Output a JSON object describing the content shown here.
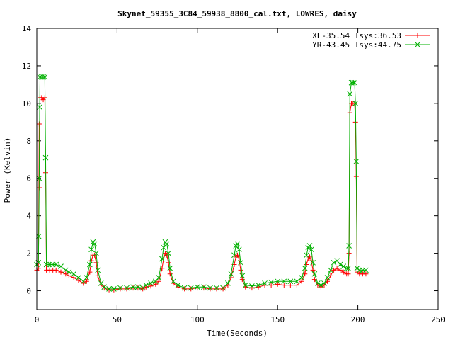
{
  "chart_data": {
    "type": "line",
    "title": "Skynet_59355_3C84_59938_8800_cal.txt, LOWRES, daisy",
    "xlabel": "Time(Seconds)",
    "ylabel": "Power (Kelvin)",
    "xlim": [
      0,
      250
    ],
    "ylim": [
      -1,
      14
    ],
    "xticks": [
      0,
      50,
      100,
      150,
      200,
      250
    ],
    "yticks": [
      0,
      2,
      4,
      6,
      8,
      10,
      12,
      14
    ],
    "grid": false,
    "legend_position": "top-right",
    "series": [
      {
        "name": "XL-35.54 Tsys:36.53",
        "color": "#ff0000",
        "marker": "plus",
        "points": [
          [
            0,
            1.1
          ],
          [
            1,
            1.2
          ],
          [
            1.5,
            8.9
          ],
          [
            1.8,
            5.5
          ],
          [
            2,
            10.3
          ],
          [
            3,
            10.3
          ],
          [
            4,
            10.2
          ],
          [
            5,
            10.3
          ],
          [
            5.5,
            6.3
          ],
          [
            6,
            1.1
          ],
          [
            8,
            1.1
          ],
          [
            10,
            1.1
          ],
          [
            12,
            1.1
          ],
          [
            15,
            1.0
          ],
          [
            18,
            0.9
          ],
          [
            20,
            0.8
          ],
          [
            23,
            0.7
          ],
          [
            26,
            0.55
          ],
          [
            29,
            0.4
          ],
          [
            31,
            0.5
          ],
          [
            33,
            1.0
          ],
          [
            34,
            1.6
          ],
          [
            35,
            1.9
          ],
          [
            36,
            1.9
          ],
          [
            37,
            1.5
          ],
          [
            38,
            0.8
          ],
          [
            40,
            0.3
          ],
          [
            42,
            0.15
          ],
          [
            45,
            0.05
          ],
          [
            48,
            0.05
          ],
          [
            52,
            0.1
          ],
          [
            56,
            0.1
          ],
          [
            60,
            0.15
          ],
          [
            63,
            0.15
          ],
          [
            66,
            0.1
          ],
          [
            68,
            0.2
          ],
          [
            71,
            0.25
          ],
          [
            74,
            0.35
          ],
          [
            76,
            0.5
          ],
          [
            78,
            1.2
          ],
          [
            79,
            1.7
          ],
          [
            80,
            2.0
          ],
          [
            81,
            1.9
          ],
          [
            82,
            1.5
          ],
          [
            83,
            0.9
          ],
          [
            85,
            0.4
          ],
          [
            88,
            0.2
          ],
          [
            92,
            0.1
          ],
          [
            96,
            0.1
          ],
          [
            100,
            0.15
          ],
          [
            104,
            0.15
          ],
          [
            108,
            0.1
          ],
          [
            112,
            0.1
          ],
          [
            116,
            0.1
          ],
          [
            119,
            0.3
          ],
          [
            121,
            0.7
          ],
          [
            123,
            1.4
          ],
          [
            124,
            1.8
          ],
          [
            125,
            1.9
          ],
          [
            126,
            1.7
          ],
          [
            127,
            1.1
          ],
          [
            128,
            0.6
          ],
          [
            130,
            0.2
          ],
          [
            134,
            0.15
          ],
          [
            138,
            0.2
          ],
          [
            142,
            0.3
          ],
          [
            146,
            0.3
          ],
          [
            150,
            0.35
          ],
          [
            154,
            0.3
          ],
          [
            158,
            0.3
          ],
          [
            162,
            0.3
          ],
          [
            165,
            0.5
          ],
          [
            167,
            0.9
          ],
          [
            168,
            1.4
          ],
          [
            169,
            1.7
          ],
          [
            170,
            1.8
          ],
          [
            171,
            1.6
          ],
          [
            172,
            1.1
          ],
          [
            173,
            0.6
          ],
          [
            175,
            0.3
          ],
          [
            177,
            0.2
          ],
          [
            179,
            0.3
          ],
          [
            181,
            0.5
          ],
          [
            183,
            0.8
          ],
          [
            185,
            1.1
          ],
          [
            187,
            1.2
          ],
          [
            189,
            1.1
          ],
          [
            191,
            1.0
          ],
          [
            193,
            0.9
          ],
          [
            194,
            0.9
          ],
          [
            194.5,
            2.0
          ],
          [
            195,
            9.5
          ],
          [
            196,
            10.0
          ],
          [
            197,
            10.0
          ],
          [
            198,
            10.0
          ],
          [
            198.5,
            9.0
          ],
          [
            199,
            6.1
          ],
          [
            199.5,
            1.0
          ],
          [
            201,
            0.9
          ],
          [
            203,
            0.9
          ],
          [
            205,
            0.9
          ]
        ]
      },
      {
        "name": "YR-43.45 Tsys:44.75",
        "color": "#00b000",
        "marker": "cross",
        "points": [
          [
            0,
            1.4
          ],
          [
            1,
            1.5
          ],
          [
            1.2,
            2.9
          ],
          [
            1.5,
            6.0
          ],
          [
            1.8,
            9.8
          ],
          [
            2,
            11.4
          ],
          [
            3,
            11.4
          ],
          [
            4,
            11.4
          ],
          [
            5,
            11.4
          ],
          [
            5.5,
            7.1
          ],
          [
            6,
            1.4
          ],
          [
            8,
            1.4
          ],
          [
            10,
            1.4
          ],
          [
            12,
            1.4
          ],
          [
            15,
            1.3
          ],
          [
            18,
            1.1
          ],
          [
            20,
            1.0
          ],
          [
            23,
            0.9
          ],
          [
            26,
            0.7
          ],
          [
            29,
            0.5
          ],
          [
            31,
            0.7
          ],
          [
            33,
            1.4
          ],
          [
            34,
            2.2
          ],
          [
            35,
            2.6
          ],
          [
            36,
            2.5
          ],
          [
            37,
            2.0
          ],
          [
            38,
            1.1
          ],
          [
            40,
            0.4
          ],
          [
            42,
            0.2
          ],
          [
            45,
            0.1
          ],
          [
            48,
            0.1
          ],
          [
            52,
            0.15
          ],
          [
            56,
            0.15
          ],
          [
            60,
            0.2
          ],
          [
            63,
            0.2
          ],
          [
            66,
            0.15
          ],
          [
            68,
            0.3
          ],
          [
            71,
            0.4
          ],
          [
            74,
            0.5
          ],
          [
            76,
            0.7
          ],
          [
            78,
            1.7
          ],
          [
            79,
            2.3
          ],
          [
            80,
            2.6
          ],
          [
            81,
            2.5
          ],
          [
            82,
            2.0
          ],
          [
            83,
            1.2
          ],
          [
            85,
            0.5
          ],
          [
            88,
            0.3
          ],
          [
            92,
            0.15
          ],
          [
            96,
            0.15
          ],
          [
            100,
            0.2
          ],
          [
            104,
            0.2
          ],
          [
            108,
            0.15
          ],
          [
            112,
            0.15
          ],
          [
            116,
            0.15
          ],
          [
            119,
            0.4
          ],
          [
            121,
            0.9
          ],
          [
            123,
            1.9
          ],
          [
            124,
            2.4
          ],
          [
            125,
            2.5
          ],
          [
            126,
            2.2
          ],
          [
            127,
            1.5
          ],
          [
            128,
            0.8
          ],
          [
            130,
            0.3
          ],
          [
            134,
            0.25
          ],
          [
            138,
            0.3
          ],
          [
            142,
            0.4
          ],
          [
            146,
            0.45
          ],
          [
            150,
            0.5
          ],
          [
            154,
            0.5
          ],
          [
            158,
            0.5
          ],
          [
            162,
            0.5
          ],
          [
            165,
            0.7
          ],
          [
            167,
            1.2
          ],
          [
            168,
            1.9
          ],
          [
            169,
            2.3
          ],
          [
            170,
            2.4
          ],
          [
            171,
            2.2
          ],
          [
            172,
            1.5
          ],
          [
            173,
            0.9
          ],
          [
            175,
            0.4
          ],
          [
            177,
            0.3
          ],
          [
            179,
            0.4
          ],
          [
            181,
            0.7
          ],
          [
            183,
            1.1
          ],
          [
            185,
            1.5
          ],
          [
            187,
            1.6
          ],
          [
            189,
            1.4
          ],
          [
            191,
            1.3
          ],
          [
            193,
            1.2
          ],
          [
            194,
            1.2
          ],
          [
            194.5,
            2.4
          ],
          [
            195,
            10.5
          ],
          [
            196,
            11.1
          ],
          [
            197,
            11.1
          ],
          [
            198,
            11.1
          ],
          [
            198.5,
            10.0
          ],
          [
            199,
            6.9
          ],
          [
            199.5,
            1.2
          ],
          [
            201,
            1.1
          ],
          [
            203,
            1.1
          ],
          [
            205,
            1.1
          ]
        ]
      }
    ]
  }
}
